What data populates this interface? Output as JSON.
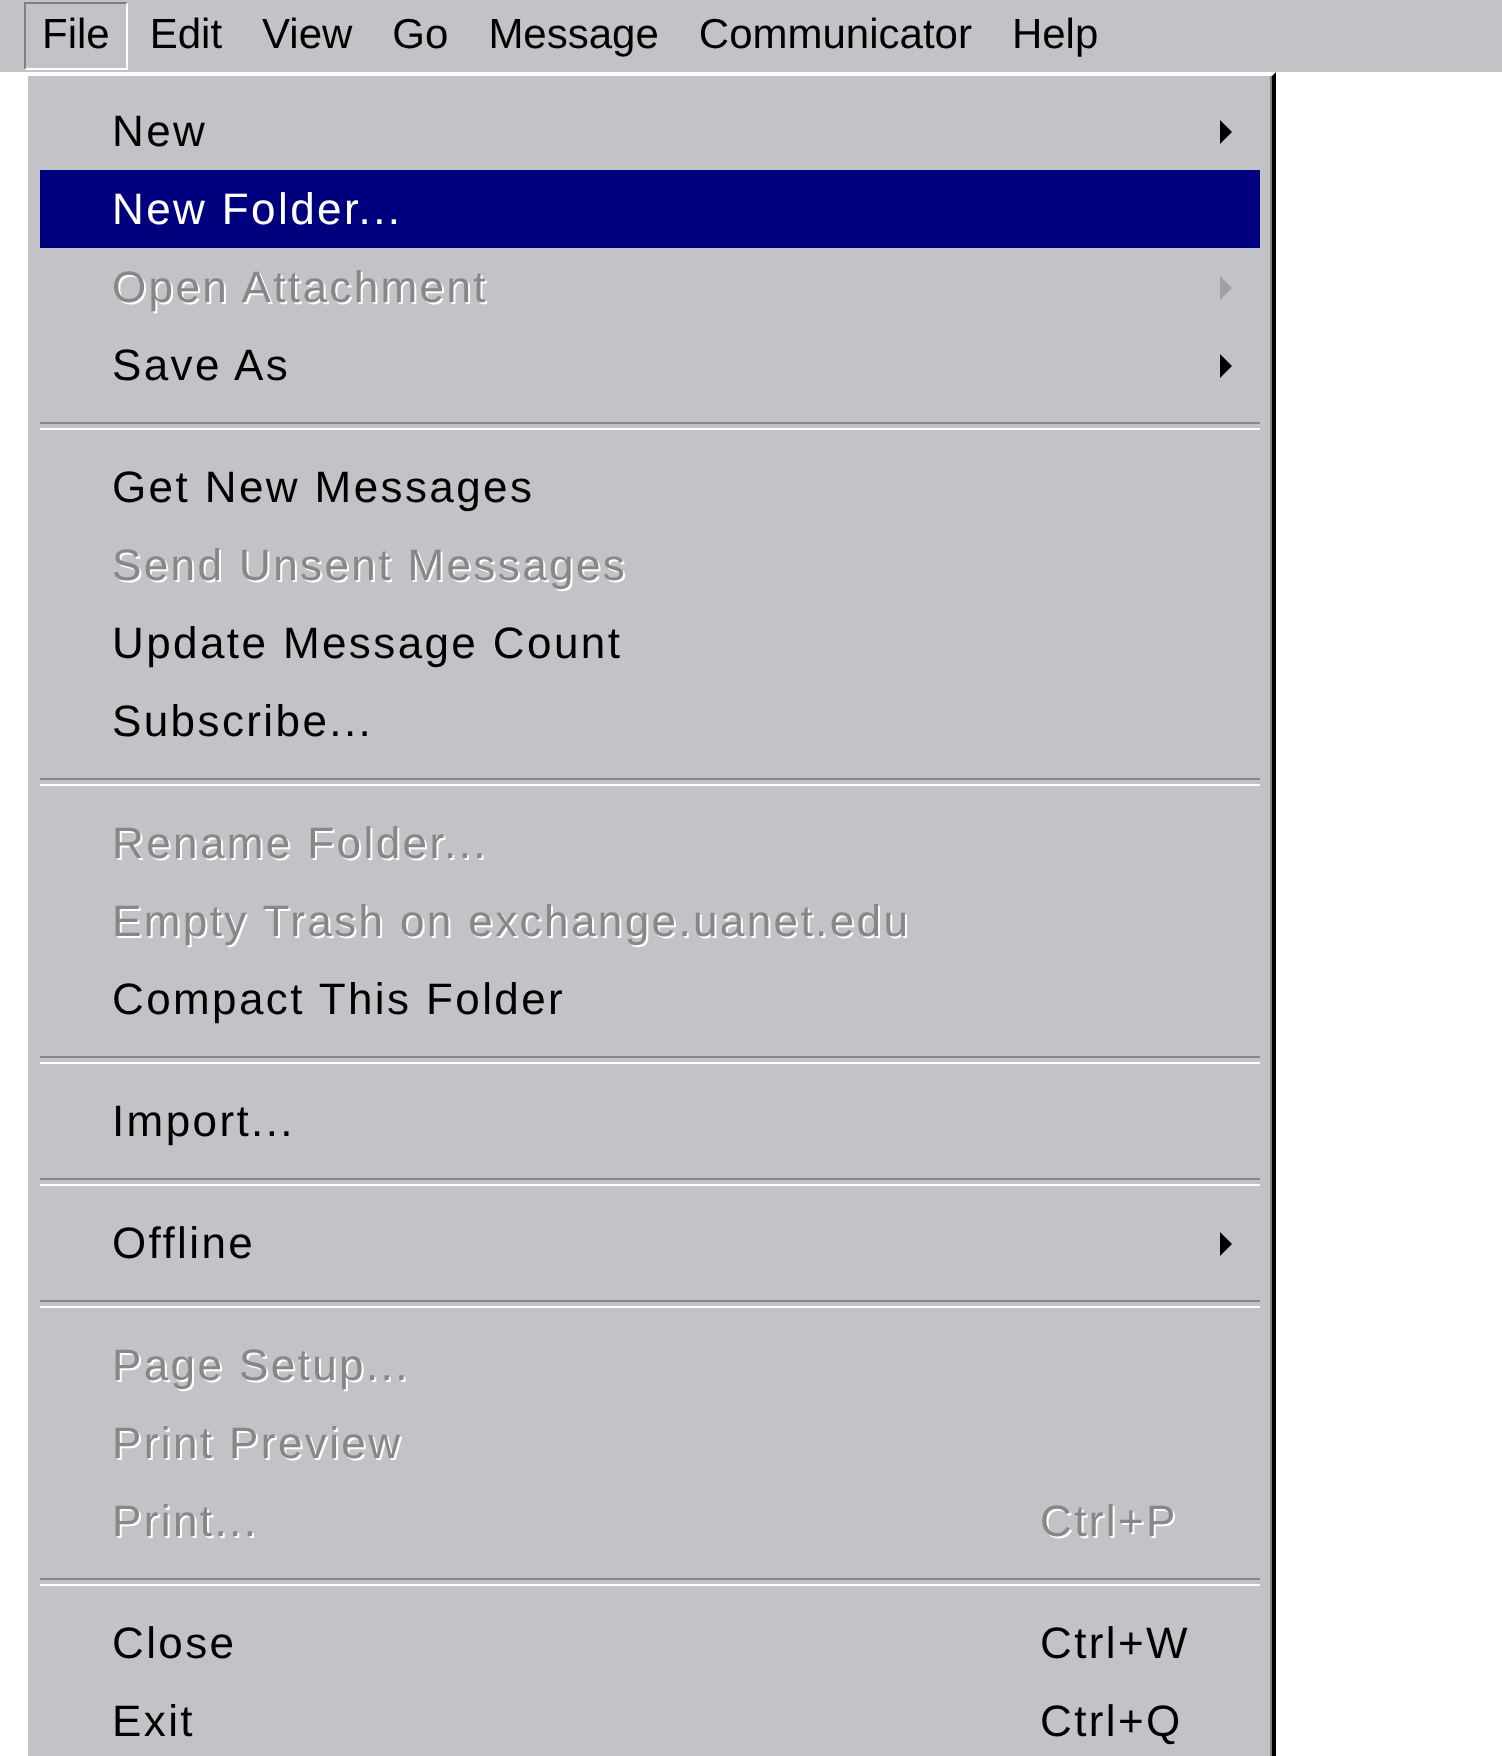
{
  "menu_bar": [
    {
      "label": "File",
      "selected": true
    },
    {
      "label": "Edit",
      "selected": false
    },
    {
      "label": "View",
      "selected": false
    },
    {
      "label": "Go",
      "selected": false
    },
    {
      "label": "Message",
      "selected": false
    },
    {
      "label": "Communicator",
      "selected": false
    },
    {
      "label": "Help",
      "selected": false
    }
  ],
  "menu": {
    "groups": [
      [
        {
          "label": "New",
          "submenu": true,
          "disabled": false,
          "selected": false
        },
        {
          "label": "New Folder...",
          "submenu": false,
          "disabled": false,
          "selected": true
        },
        {
          "label": "Open Attachment",
          "submenu": true,
          "disabled": true,
          "selected": false
        },
        {
          "label": "Save As",
          "submenu": true,
          "disabled": false,
          "selected": false
        }
      ],
      [
        {
          "label": "Get New Messages",
          "submenu": false,
          "disabled": false,
          "selected": false
        },
        {
          "label": "Send Unsent Messages",
          "submenu": false,
          "disabled": true,
          "selected": false
        },
        {
          "label": "Update Message Count",
          "submenu": false,
          "disabled": false,
          "selected": false
        },
        {
          "label": "Subscribe...",
          "submenu": false,
          "disabled": false,
          "selected": false
        }
      ],
      [
        {
          "label": "Rename Folder...",
          "submenu": false,
          "disabled": true,
          "selected": false
        },
        {
          "label": "Empty Trash on exchange.uanet.edu",
          "submenu": false,
          "disabled": true,
          "selected": false
        },
        {
          "label": "Compact This Folder",
          "submenu": false,
          "disabled": false,
          "selected": false
        }
      ],
      [
        {
          "label": "Import...",
          "submenu": false,
          "disabled": false,
          "selected": false
        }
      ],
      [
        {
          "label": "Offline",
          "submenu": true,
          "disabled": false,
          "selected": false
        }
      ],
      [
        {
          "label": "Page Setup...",
          "submenu": false,
          "disabled": true,
          "selected": false
        },
        {
          "label": "Print Preview",
          "submenu": false,
          "disabled": true,
          "selected": false
        },
        {
          "label": "Print...",
          "shortcut": "Ctrl+P",
          "submenu": false,
          "disabled": true,
          "selected": false
        }
      ],
      [
        {
          "label": "Close",
          "shortcut": "Ctrl+W",
          "submenu": false,
          "disabled": false,
          "selected": false
        },
        {
          "label": "Exit",
          "shortcut": "Ctrl+Q",
          "submenu": false,
          "disabled": false,
          "selected": false
        }
      ]
    ]
  }
}
